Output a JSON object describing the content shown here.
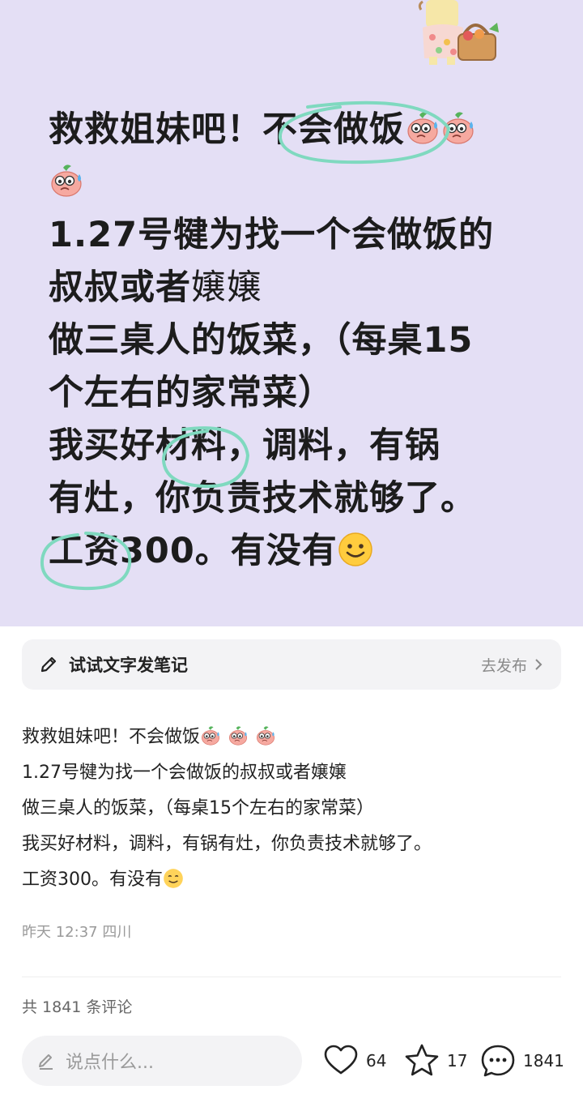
{
  "post_image": {
    "lines": [
      "救救姐妹吧！不会做饭",
      "1.27号犍为找一个会做饭的",
      "叔叔或者",
      "嬢嬢",
      "做三桌人的饭菜，（每桌15",
      "个左右的家常菜）",
      "我买好材料，调料，有锅",
      "有灶，你负责技术就够了。",
      "工资300。有没有"
    ],
    "emojis": [
      "sweating-peach-emoji",
      "smiling-emoji"
    ]
  },
  "prompt_bar": {
    "label": "试试文字发笔记",
    "action": "去发布"
  },
  "caption": {
    "lines": [
      "救救姐妹吧！不会做饭",
      "1.27号犍为找一个会做饭的叔叔或者嬢嬢",
      "做三桌人的饭菜，（每桌15个左右的家常菜）",
      "我买好材料，调料，有锅有灶，你负责技术就够了。",
      "工资300。有没有"
    ]
  },
  "meta": {
    "time_location": "昨天 12:37 四川"
  },
  "comments": {
    "count_text": "共 1841 条评论"
  },
  "bottom_bar": {
    "input_placeholder": "说点什么...",
    "likes": "64",
    "stars": "17",
    "comments": "1841"
  },
  "colors": {
    "background": "#e4dff5",
    "circle_mark": "#7fd9bf",
    "text": "#1c1c1c"
  }
}
